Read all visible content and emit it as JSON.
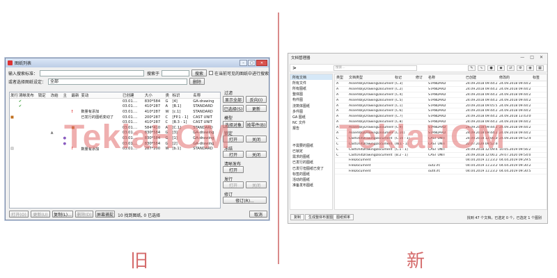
{
  "old": {
    "title": "图纸列表",
    "search_label": "输入搜索标准：",
    "search_in_label": "搜索于",
    "search_button": "搜索",
    "visible_only_label": "在当前可见的图纸中进行搜索",
    "saved_label": "或者选择图纸设定：",
    "saved_value": "全部",
    "delete_button": "删除",
    "columns": [
      "发行",
      "清晰发布",
      "锁定",
      "冻结",
      "主",
      "最新",
      "变动",
      "已创建",
      "大小",
      "类",
      "标识",
      "名称"
    ],
    "rows": [
      {
        "c6": "",
        "c7": "03.01....",
        "c8": "830*584",
        "c9": "G",
        "c10": "[4]",
        "c11": "GA-drawing"
      },
      {
        "c6": "",
        "c7": "03.01....",
        "c8": "410*287",
        "c9": "A",
        "c10": "[B.1]",
        "c11": "STANDARD"
      },
      {
        "c6": "数量有添加",
        "c7": "03.01....",
        "c8": "410*287",
        "c9": "W",
        "c10": "[c.1]",
        "c11": "STANDARD"
      },
      {
        "c6": "已发行的图纸变动了",
        "c7": "03.01....",
        "c8": "200*287",
        "c9": "C",
        "c10": "[FP.1 - 1]",
        "c11": "CAST UNIT"
      },
      {
        "c6": "",
        "c7": "03.01....",
        "c8": "410*287",
        "c9": "C",
        "c10": "[B.3 - 1]",
        "c11": "CAST UNIT"
      },
      {
        "c6": "",
        "c7": "03.01....",
        "c8": "584*410",
        "c9": "A",
        "c10": "[C.1]",
        "c11": "STANDARD"
      },
      {
        "c6": "",
        "c7": "03.01....",
        "c8": "830*584",
        "c9": "G",
        "c10": "[3]",
        "c11": "GA-drawing"
      },
      {
        "c6": "",
        "c7": "03.01....",
        "c8": "830*584",
        "c9": "G",
        "c10": "[1]",
        "c11": "GA-drawing"
      },
      {
        "c6": "",
        "c7": "03.01....",
        "c8": "830*584",
        "c9": "G",
        "c10": "[2]",
        "c11": "GA-drawing"
      },
      {
        "c6": "数量有添加",
        "c7": "03.01....",
        "c8": "287*200",
        "c9": "W",
        "c10": "[b.1]",
        "c11": "STANDARD"
      }
    ],
    "filter_label": "过滤",
    "show_all": "显示全部",
    "reverse": "反向(I)",
    "selected": "已选择(S)",
    "update": "更新",
    "model_label": "模型",
    "select_object": "选择对象",
    "by_part": "按零件(B)",
    "lock_label": "锁定",
    "open": "打开",
    "close": "关闭",
    "freeze_label": "冻结",
    "clear_label": "清晰发布",
    "issue_label": "发行",
    "revise_label": "修订",
    "revise_button": "修订(R)...",
    "bottom": [
      "打开(O)",
      "更新(U)",
      "复制(L)...",
      "删除(D)",
      "屏幕捕捉"
    ],
    "status": "10 找到图纸, 0 已选择",
    "cancel": "取消",
    "caption": "旧"
  },
  "new": {
    "title": "文档管理器",
    "search_placeholder": "搜索...",
    "left": [
      "所有文档",
      "所有文件",
      "所有图纸",
      "整体图",
      "构件图",
      "浇筑体图纸",
      "多件图",
      "GA 图纸",
      "NC 文件",
      "报告",
      "",
      "",
      "不需要的图纸",
      "已锁定",
      "需求的图纸",
      "已发行的图纸",
      "已发行但图纸已变了",
      "标签的图纸",
      "活动的图纸",
      "准备发布图纸"
    ],
    "columns": [
      "类型",
      "文档类型",
      "标记",
      "修订",
      "名称",
      "已创建",
      "修改的",
      "标签"
    ],
    "rows": [
      [
        "A",
        "AssemblyDrawingDocument",
        "[C.3]",
        "",
        "STANDARD",
        "24.09.2018 09:44:22",
        "24.09.2018 09:44:22"
      ],
      [
        "A",
        "AssemblyDrawingDocument",
        "[C.2]",
        "",
        "STANDARD",
        "24.09.2018 09:44:22",
        "24.09.2018 09:44:22"
      ],
      [
        "A",
        "AssemblyDrawingDocument",
        "[C.4]",
        "",
        "STANDARD",
        "24.09.2018 09:44:22",
        "24.09.2018 09:44:22"
      ],
      [
        "A",
        "AssemblyDrawingDocument",
        "[C.5]",
        "",
        "STANDARD",
        "24.09.2018 09:44:24",
        "24.09.2018 09:44:24"
      ],
      [
        "A",
        "AssemblyDrawingDocument",
        "[C.1]",
        "",
        "STANDARD",
        "20.09.2018 09:05:57",
        "24.09.2018 09:44:25"
      ],
      [
        "A",
        "AssemblyDrawingDocument",
        "[C.6]",
        "",
        "STANDARD",
        "24.09.2018 09:44:22",
        "24.09.2018 09:44:22"
      ],
      [
        "A",
        "AssemblyDrawingDocument",
        "[C.7]",
        "",
        "STANDARD",
        "24.09.2018 09:44:22",
        "24.09.2018 13:43:09"
      ],
      [
        "A",
        "AssemblyDrawingDocument",
        "[C.8]",
        "",
        "STANDARD",
        "24.09.2018 09:44:22",
        "24.09.2018 09:44:22"
      ],
      [
        "A",
        "AssemblyDrawingDocument",
        "[C.9]",
        "",
        "STANDARD",
        "24.09.2018 09:44:23",
        "24.09.2018 09:44:23"
      ],
      [
        "A",
        "AssemblyDrawingDocument",
        "[C.10]",
        "",
        "STANDARD",
        "24.09.2018 09:44:22",
        "24.09.2018 09:44:22"
      ],
      [
        "C",
        "CastUnitDrawingDocument",
        "[C.10 - 1]",
        "",
        "CAST UNIT",
        "24.09.2018 12:06:39",
        "24.09.2018 09:52:40"
      ],
      [
        "C",
        "CastUnitDrawingDocument",
        "[W.1 - 1]",
        "",
        "CAST UNIT",
        "22.07.2020 09:52:40",
        ""
      ],
      [
        "C",
        "CastUnitDrawingDocument",
        "[C.1 - 1]",
        "",
        "CAST UNIT",
        "24.09.2018 12:09:43",
        "10.05.2019 09:56:21"
      ],
      [
        "C",
        "CastUnitDrawingDocument",
        "[B.2 - 1]",
        "",
        "CAST UNIT",
        "24.09.2018 12:06:24",
        "29.07.2020 09:54:07"
      ],
      [
        "",
        "FileDocument",
        "",
        "",
        "",
        "04.04.2019 11:23:20",
        "04.04.2019 09:29:51"
      ],
      [
        "",
        "FileDocument",
        "",
        "",
        "out2.ifc",
        "04.04.2019 11:23:20",
        "04.04.2019 09:30:24"
      ],
      [
        "",
        "FileDocument",
        "",
        "",
        "out4.ifc",
        "04.04.2019 11:23:20",
        "04.04.2019 09:30:51"
      ]
    ],
    "bottom": [
      "复制",
      "生成整体布置图",
      "图纸频率"
    ],
    "status": "找到 47 个文档，已选定 0 个，已选定 1 个图别",
    "caption": "新"
  },
  "watermark": "TeklaHOM"
}
